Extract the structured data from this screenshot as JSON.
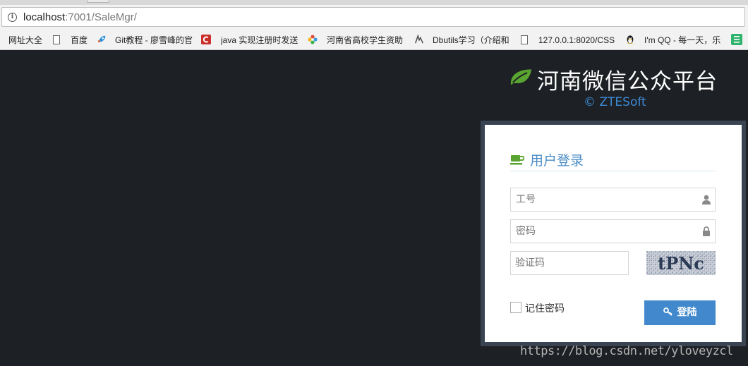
{
  "browser": {
    "url_host": "localhost",
    "url_rest": ":7001/SaleMgr/",
    "bookmarks": [
      {
        "label": "网址大全"
      },
      {
        "label": "百度"
      },
      {
        "label": "Git教程 - 廖雪峰的官"
      },
      {
        "label": "java 实现注册时发送"
      },
      {
        "label": "河南省高校学生资助"
      },
      {
        "label": "Dbutils学习（介绍和"
      },
      {
        "label": "127.0.0.1:8020/CSS"
      },
      {
        "label": "I'm QQ - 每一天，乐"
      }
    ]
  },
  "brand": {
    "title": "河南微信公众平台",
    "copyright": "© ZTESoft"
  },
  "login": {
    "title": "用户登录",
    "username_placeholder": "工号",
    "password_placeholder": "密码",
    "captcha_placeholder": "验证码",
    "captcha_text": "tPNc",
    "remember_label": "记住密码",
    "remember_checked": false,
    "submit_label": "登陆"
  },
  "watermark": "https://blog.csdn.net/yloveyzcl",
  "colors": {
    "page_bg": "#1d2024",
    "brand_leaf": "#5aa532",
    "accent_blue": "#4189cc",
    "login_frame": "#3a4351"
  }
}
